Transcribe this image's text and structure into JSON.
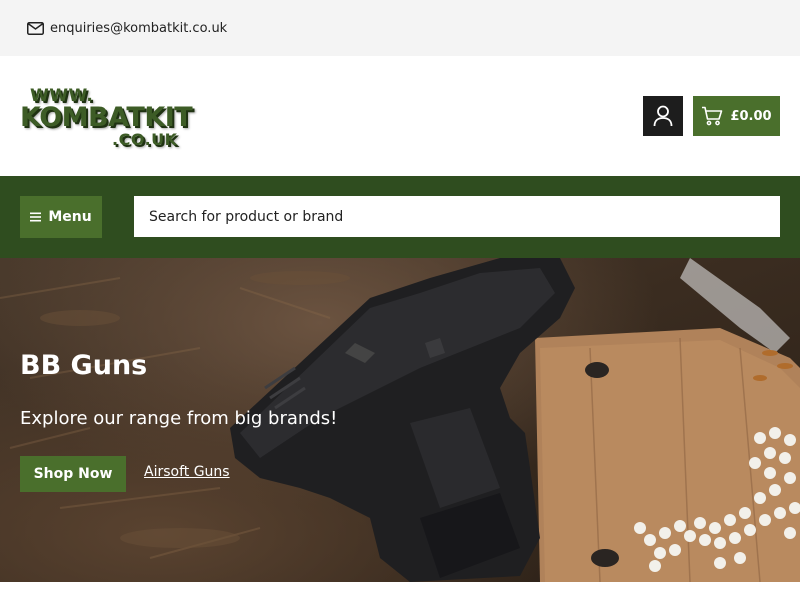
{
  "topbar": {
    "email": "enquiries@kombatkit.co.uk",
    "icon": "envelope-icon"
  },
  "header": {
    "logo": {
      "line1": "WWW.",
      "line2": "KOMBATKIT",
      "line3": ".CO.UK"
    },
    "account_icon": "user-icon",
    "cart": {
      "icon": "cart-icon",
      "total": "£0.00"
    }
  },
  "nav": {
    "menu_label": "Menu",
    "search_placeholder": "Search for product or brand"
  },
  "hero": {
    "title": "BB Guns",
    "subtitle": "Explore our range from big brands!",
    "cta_label": "Shop Now",
    "link_label": "Airsoft Guns"
  },
  "colors": {
    "brand_green": "#4a6f2c",
    "nav_dark_green": "#2f4d1f",
    "account_black": "#1d1d1d"
  }
}
